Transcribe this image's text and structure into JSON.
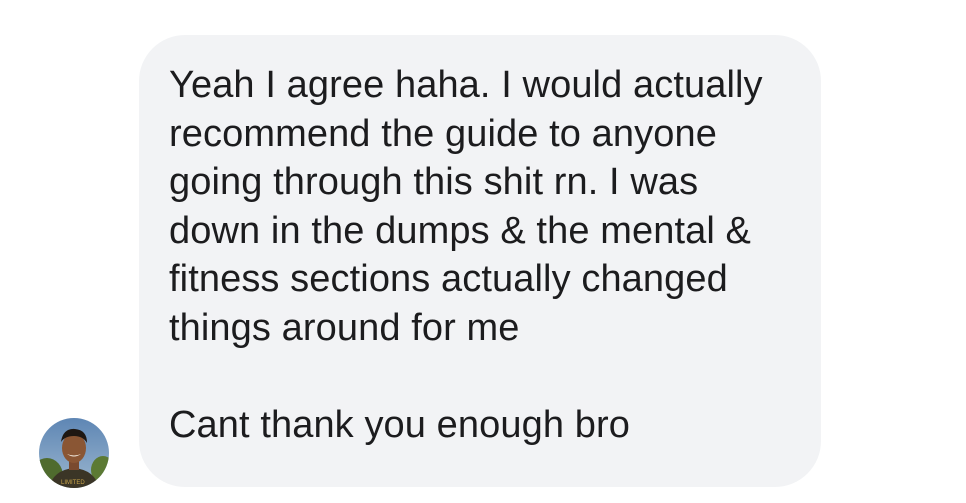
{
  "message": {
    "lines": [
      "Yeah I agree haha. I would actually",
      "recommend the guide to anyone",
      "going through this shit rn. I was",
      "down in the dumps & the mental &",
      "fitness sections actually changed",
      "things around for me"
    ],
    "closing_line": "Cant thank you enough bro"
  },
  "avatar": {
    "icon": "profile-photo",
    "shirt_text": "LIMITED"
  },
  "colors": {
    "bubble_background": "#f2f3f5",
    "text": "#1c1c1e",
    "page_background": "#ffffff"
  }
}
